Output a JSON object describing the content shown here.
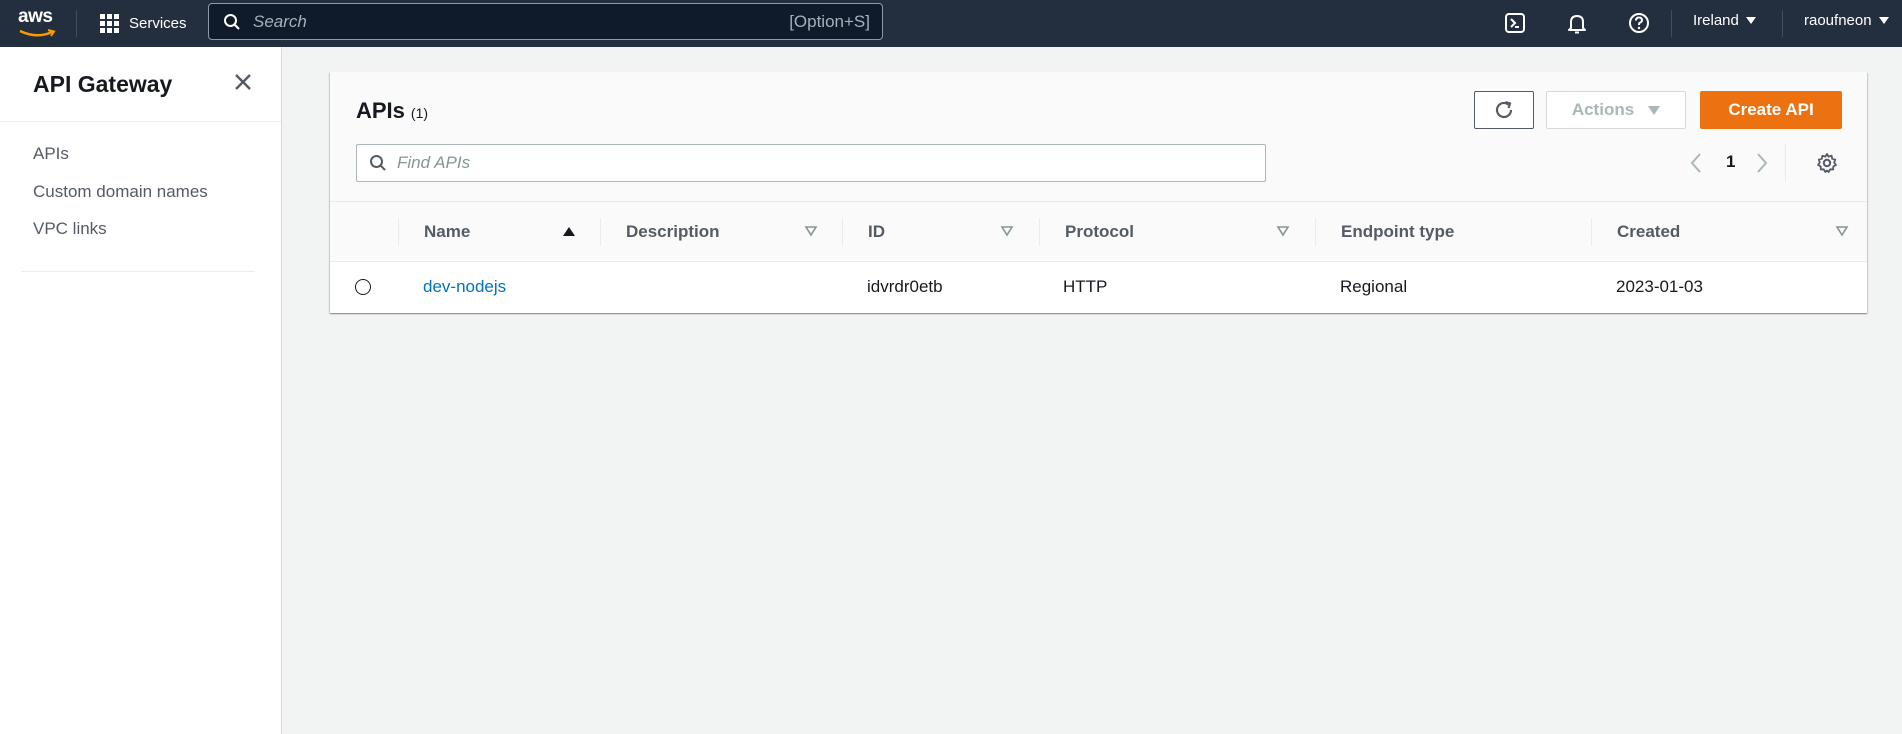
{
  "topnav": {
    "logo_text": "aws",
    "services_label": "Services",
    "search_placeholder": "Search",
    "search_shortcut": "[Option+S]",
    "region_label": "Ireland",
    "account_label": "raoufneon"
  },
  "sidebar": {
    "title": "API Gateway",
    "items": [
      {
        "label": "APIs"
      },
      {
        "label": "Custom domain names"
      },
      {
        "label": "VPC links"
      }
    ]
  },
  "apis_panel": {
    "title": "APIs",
    "count": "(1)",
    "actions_label": "Actions",
    "create_label": "Create API",
    "filter_placeholder": "Find APIs",
    "page_number": "1",
    "columns": [
      "Name",
      "Description",
      "ID",
      "Protocol",
      "Endpoint type",
      "Created"
    ],
    "rows": [
      {
        "name": "dev-nodejs",
        "description": "",
        "id": "idvrdr0etb",
        "protocol": "HTTP",
        "endpoint_type": "Regional",
        "created": "2023-01-03"
      }
    ]
  },
  "colors": {
    "nav_bg": "#232f3e",
    "accent_orange": "#ec7211",
    "link_blue": "#0073bb",
    "page_bg": "#f2f3f3"
  }
}
